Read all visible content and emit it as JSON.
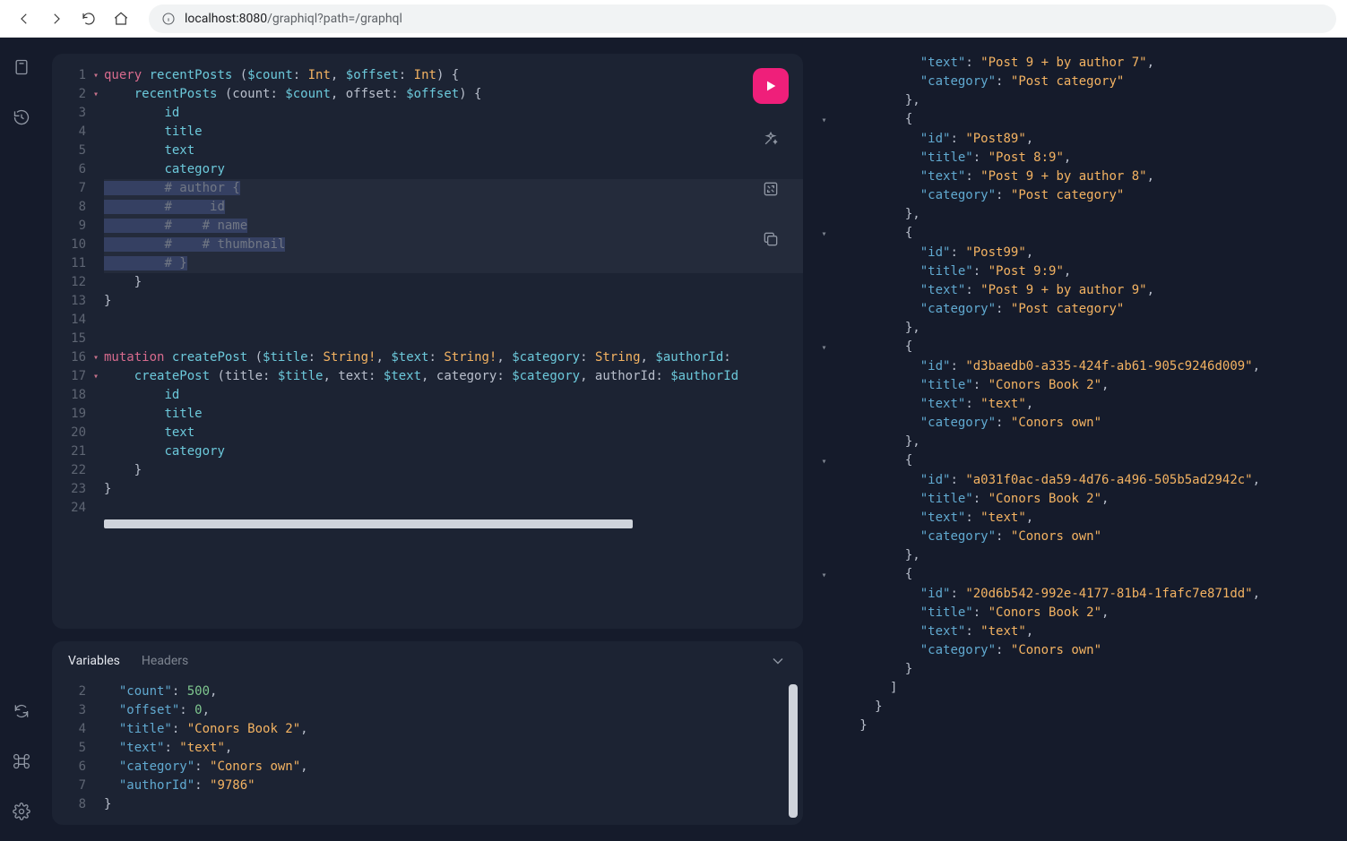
{
  "browser": {
    "url_host": "localhost:8080",
    "url_path": "/graphiql?path=/graphql"
  },
  "editor": {
    "lines": [
      {
        "n": 1,
        "fold": "▾",
        "tokens": [
          [
            "kw",
            "query"
          ],
          [
            "punc",
            " "
          ],
          [
            "op",
            "recentPosts"
          ],
          [
            "punc",
            " ("
          ],
          [
            "var",
            "$count"
          ],
          [
            "punc",
            ": "
          ],
          [
            "typ",
            "Int"
          ],
          [
            "punc",
            ", "
          ],
          [
            "var",
            "$offset"
          ],
          [
            "punc",
            ": "
          ],
          [
            "typ",
            "Int"
          ],
          [
            "punc",
            ") {"
          ]
        ]
      },
      {
        "n": 2,
        "fold": "▾",
        "tokens": [
          [
            "punc",
            "    "
          ],
          [
            "fld",
            "recentPosts"
          ],
          [
            "punc",
            " (count: "
          ],
          [
            "var",
            "$count"
          ],
          [
            "punc",
            ", offset: "
          ],
          [
            "var",
            "$offset"
          ],
          [
            "punc",
            ") {"
          ]
        ]
      },
      {
        "n": 3,
        "tokens": [
          [
            "punc",
            "        "
          ],
          [
            "fld",
            "id"
          ]
        ]
      },
      {
        "n": 4,
        "tokens": [
          [
            "punc",
            "        "
          ],
          [
            "fld",
            "title"
          ]
        ]
      },
      {
        "n": 5,
        "tokens": [
          [
            "punc",
            "        "
          ],
          [
            "fld",
            "text"
          ]
        ]
      },
      {
        "n": 6,
        "tokens": [
          [
            "punc",
            "        "
          ],
          [
            "fld",
            "category"
          ]
        ]
      },
      {
        "n": 7,
        "sel": true,
        "tokens": [
          [
            "punc",
            "        "
          ],
          [
            "cmt",
            "# author {"
          ]
        ]
      },
      {
        "n": 8,
        "sel": true,
        "tokens": [
          [
            "punc",
            "        "
          ],
          [
            "cmt",
            "#     id"
          ]
        ]
      },
      {
        "n": 9,
        "sel": true,
        "tokens": [
          [
            "punc",
            "        "
          ],
          [
            "cmt",
            "#    # name"
          ]
        ]
      },
      {
        "n": 10,
        "sel": true,
        "tokens": [
          [
            "punc",
            "        "
          ],
          [
            "cmt",
            "#    # thumbnail"
          ]
        ]
      },
      {
        "n": 11,
        "sel": true,
        "tokens": [
          [
            "punc",
            "        "
          ],
          [
            "cmt",
            "# }"
          ]
        ]
      },
      {
        "n": 12,
        "tokens": [
          [
            "punc",
            "    }"
          ]
        ]
      },
      {
        "n": 13,
        "tokens": [
          [
            "punc",
            "}"
          ]
        ]
      },
      {
        "n": 14,
        "tokens": [
          [
            "punc",
            ""
          ]
        ]
      },
      {
        "n": 15,
        "tokens": [
          [
            "punc",
            ""
          ]
        ]
      },
      {
        "n": 16,
        "fold": "▾",
        "tokens": [
          [
            "kw",
            "mutation"
          ],
          [
            "punc",
            " "
          ],
          [
            "op",
            "createPost"
          ],
          [
            "punc",
            " ("
          ],
          [
            "var",
            "$title"
          ],
          [
            "punc",
            ": "
          ],
          [
            "typ",
            "String!"
          ],
          [
            "punc",
            ", "
          ],
          [
            "var",
            "$text"
          ],
          [
            "punc",
            ": "
          ],
          [
            "typ",
            "String!"
          ],
          [
            "punc",
            ", "
          ],
          [
            "var",
            "$category"
          ],
          [
            "punc",
            ": "
          ],
          [
            "typ",
            "String"
          ],
          [
            "punc",
            ", "
          ],
          [
            "var",
            "$authorId"
          ],
          [
            "punc",
            ":"
          ]
        ]
      },
      {
        "n": 17,
        "fold": "▾",
        "tokens": [
          [
            "punc",
            "    "
          ],
          [
            "fld",
            "createPost"
          ],
          [
            "punc",
            " (title: "
          ],
          [
            "var",
            "$title"
          ],
          [
            "punc",
            ", text: "
          ],
          [
            "var",
            "$text"
          ],
          [
            "punc",
            ", category: "
          ],
          [
            "var",
            "$category"
          ],
          [
            "punc",
            ", authorId: "
          ],
          [
            "var",
            "$authorId"
          ]
        ]
      },
      {
        "n": 18,
        "tokens": [
          [
            "punc",
            "        "
          ],
          [
            "fld",
            "id"
          ]
        ]
      },
      {
        "n": 19,
        "tokens": [
          [
            "punc",
            "        "
          ],
          [
            "fld",
            "title"
          ]
        ]
      },
      {
        "n": 20,
        "tokens": [
          [
            "punc",
            "        "
          ],
          [
            "fld",
            "text"
          ]
        ]
      },
      {
        "n": 21,
        "tokens": [
          [
            "punc",
            "        "
          ],
          [
            "fld",
            "category"
          ]
        ]
      },
      {
        "n": 22,
        "tokens": [
          [
            "punc",
            "    }"
          ]
        ]
      },
      {
        "n": 23,
        "tokens": [
          [
            "punc",
            "}"
          ]
        ]
      },
      {
        "n": 24,
        "tokens": [
          [
            "punc",
            ""
          ]
        ]
      }
    ]
  },
  "vars_tabs": {
    "variables": "Variables",
    "headers": "Headers"
  },
  "variables": {
    "lines": [
      {
        "n": 2,
        "tokens": [
          [
            "punc",
            "  "
          ],
          [
            "key",
            "\"count\""
          ],
          [
            "punc",
            ": "
          ],
          [
            "num",
            "500"
          ],
          [
            "punc",
            ","
          ]
        ]
      },
      {
        "n": 3,
        "tokens": [
          [
            "punc",
            "  "
          ],
          [
            "key",
            "\"offset\""
          ],
          [
            "punc",
            ": "
          ],
          [
            "num",
            "0"
          ],
          [
            "punc",
            ","
          ]
        ]
      },
      {
        "n": 4,
        "tokens": [
          [
            "punc",
            "  "
          ],
          [
            "key",
            "\"title\""
          ],
          [
            "punc",
            ": "
          ],
          [
            "str",
            "\"Conors Book 2\""
          ],
          [
            "punc",
            ","
          ]
        ]
      },
      {
        "n": 5,
        "tokens": [
          [
            "punc",
            "  "
          ],
          [
            "key",
            "\"text\""
          ],
          [
            "punc",
            ": "
          ],
          [
            "str",
            "\"text\""
          ],
          [
            "punc",
            ","
          ]
        ]
      },
      {
        "n": 6,
        "tokens": [
          [
            "punc",
            "  "
          ],
          [
            "key",
            "\"category\""
          ],
          [
            "punc",
            ": "
          ],
          [
            "str",
            "\"Conors own\""
          ],
          [
            "punc",
            ","
          ]
        ]
      },
      {
        "n": 7,
        "tokens": [
          [
            "punc",
            "  "
          ],
          [
            "key",
            "\"authorId\""
          ],
          [
            "punc",
            ": "
          ],
          [
            "str",
            "\"9786\""
          ]
        ]
      },
      {
        "n": 8,
        "tokens": [
          [
            "punc",
            "}"
          ]
        ]
      }
    ]
  },
  "result": {
    "lines": [
      {
        "indent": 5,
        "tokens": [
          [
            "key",
            "\"text\""
          ],
          [
            "punc",
            ": "
          ],
          [
            "jstr",
            "\"Post 9 + by author 7\""
          ],
          [
            "punc",
            ","
          ]
        ]
      },
      {
        "indent": 5,
        "tokens": [
          [
            "key",
            "\"category\""
          ],
          [
            "punc",
            ": "
          ],
          [
            "jstr",
            "\"Post category\""
          ]
        ]
      },
      {
        "indent": 4,
        "tokens": [
          [
            "punc",
            "},"
          ]
        ]
      },
      {
        "indent": 4,
        "fold": "▾",
        "tokens": [
          [
            "punc",
            "{"
          ]
        ]
      },
      {
        "indent": 5,
        "tokens": [
          [
            "key",
            "\"id\""
          ],
          [
            "punc",
            ": "
          ],
          [
            "jstr",
            "\"Post89\""
          ],
          [
            "punc",
            ","
          ]
        ]
      },
      {
        "indent": 5,
        "tokens": [
          [
            "key",
            "\"title\""
          ],
          [
            "punc",
            ": "
          ],
          [
            "jstr",
            "\"Post 8:9\""
          ],
          [
            "punc",
            ","
          ]
        ]
      },
      {
        "indent": 5,
        "tokens": [
          [
            "key",
            "\"text\""
          ],
          [
            "punc",
            ": "
          ],
          [
            "jstr",
            "\"Post 9 + by author 8\""
          ],
          [
            "punc",
            ","
          ]
        ]
      },
      {
        "indent": 5,
        "tokens": [
          [
            "key",
            "\"category\""
          ],
          [
            "punc",
            ": "
          ],
          [
            "jstr",
            "\"Post category\""
          ]
        ]
      },
      {
        "indent": 4,
        "tokens": [
          [
            "punc",
            "},"
          ]
        ]
      },
      {
        "indent": 4,
        "fold": "▾",
        "tokens": [
          [
            "punc",
            "{"
          ]
        ]
      },
      {
        "indent": 5,
        "tokens": [
          [
            "key",
            "\"id\""
          ],
          [
            "punc",
            ": "
          ],
          [
            "jstr",
            "\"Post99\""
          ],
          [
            "punc",
            ","
          ]
        ]
      },
      {
        "indent": 5,
        "tokens": [
          [
            "key",
            "\"title\""
          ],
          [
            "punc",
            ": "
          ],
          [
            "jstr",
            "\"Post 9:9\""
          ],
          [
            "punc",
            ","
          ]
        ]
      },
      {
        "indent": 5,
        "tokens": [
          [
            "key",
            "\"text\""
          ],
          [
            "punc",
            ": "
          ],
          [
            "jstr",
            "\"Post 9 + by author 9\""
          ],
          [
            "punc",
            ","
          ]
        ]
      },
      {
        "indent": 5,
        "tokens": [
          [
            "key",
            "\"category\""
          ],
          [
            "punc",
            ": "
          ],
          [
            "jstr",
            "\"Post category\""
          ]
        ]
      },
      {
        "indent": 4,
        "tokens": [
          [
            "punc",
            "},"
          ]
        ]
      },
      {
        "indent": 4,
        "fold": "▾",
        "tokens": [
          [
            "punc",
            "{"
          ]
        ]
      },
      {
        "indent": 5,
        "tokens": [
          [
            "key",
            "\"id\""
          ],
          [
            "punc",
            ": "
          ],
          [
            "jstr",
            "\"d3baedb0-a335-424f-ab61-905c9246d009\""
          ],
          [
            "punc",
            ","
          ]
        ]
      },
      {
        "indent": 5,
        "tokens": [
          [
            "key",
            "\"title\""
          ],
          [
            "punc",
            ": "
          ],
          [
            "jstr",
            "\"Conors Book 2\""
          ],
          [
            "punc",
            ","
          ]
        ]
      },
      {
        "indent": 5,
        "tokens": [
          [
            "key",
            "\"text\""
          ],
          [
            "punc",
            ": "
          ],
          [
            "jstr",
            "\"text\""
          ],
          [
            "punc",
            ","
          ]
        ]
      },
      {
        "indent": 5,
        "tokens": [
          [
            "key",
            "\"category\""
          ],
          [
            "punc",
            ": "
          ],
          [
            "jstr",
            "\"Conors own\""
          ]
        ]
      },
      {
        "indent": 4,
        "tokens": [
          [
            "punc",
            "},"
          ]
        ]
      },
      {
        "indent": 4,
        "fold": "▾",
        "tokens": [
          [
            "punc",
            "{"
          ]
        ]
      },
      {
        "indent": 5,
        "tokens": [
          [
            "key",
            "\"id\""
          ],
          [
            "punc",
            ": "
          ],
          [
            "jstr",
            "\"a031f0ac-da59-4d76-a496-505b5ad2942c\""
          ],
          [
            "punc",
            ","
          ]
        ]
      },
      {
        "indent": 5,
        "tokens": [
          [
            "key",
            "\"title\""
          ],
          [
            "punc",
            ": "
          ],
          [
            "jstr",
            "\"Conors Book 2\""
          ],
          [
            "punc",
            ","
          ]
        ]
      },
      {
        "indent": 5,
        "tokens": [
          [
            "key",
            "\"text\""
          ],
          [
            "punc",
            ": "
          ],
          [
            "jstr",
            "\"text\""
          ],
          [
            "punc",
            ","
          ]
        ]
      },
      {
        "indent": 5,
        "tokens": [
          [
            "key",
            "\"category\""
          ],
          [
            "punc",
            ": "
          ],
          [
            "jstr",
            "\"Conors own\""
          ]
        ]
      },
      {
        "indent": 4,
        "tokens": [
          [
            "punc",
            "},"
          ]
        ]
      },
      {
        "indent": 4,
        "fold": "▾",
        "tokens": [
          [
            "punc",
            "{"
          ]
        ]
      },
      {
        "indent": 5,
        "tokens": [
          [
            "key",
            "\"id\""
          ],
          [
            "punc",
            ": "
          ],
          [
            "jstr",
            "\"20d6b542-992e-4177-81b4-1fafc7e871dd\""
          ],
          [
            "punc",
            ","
          ]
        ]
      },
      {
        "indent": 5,
        "tokens": [
          [
            "key",
            "\"title\""
          ],
          [
            "punc",
            ": "
          ],
          [
            "jstr",
            "\"Conors Book 2\""
          ],
          [
            "punc",
            ","
          ]
        ]
      },
      {
        "indent": 5,
        "tokens": [
          [
            "key",
            "\"text\""
          ],
          [
            "punc",
            ": "
          ],
          [
            "jstr",
            "\"text\""
          ],
          [
            "punc",
            ","
          ]
        ]
      },
      {
        "indent": 5,
        "tokens": [
          [
            "key",
            "\"category\""
          ],
          [
            "punc",
            ": "
          ],
          [
            "jstr",
            "\"Conors own\""
          ]
        ]
      },
      {
        "indent": 4,
        "tokens": [
          [
            "punc",
            "}"
          ]
        ]
      },
      {
        "indent": 3,
        "tokens": [
          [
            "punc",
            "]"
          ]
        ]
      },
      {
        "indent": 2,
        "tokens": [
          [
            "punc",
            "}"
          ]
        ]
      },
      {
        "indent": 1,
        "tokens": [
          [
            "punc",
            "}"
          ]
        ]
      }
    ]
  }
}
